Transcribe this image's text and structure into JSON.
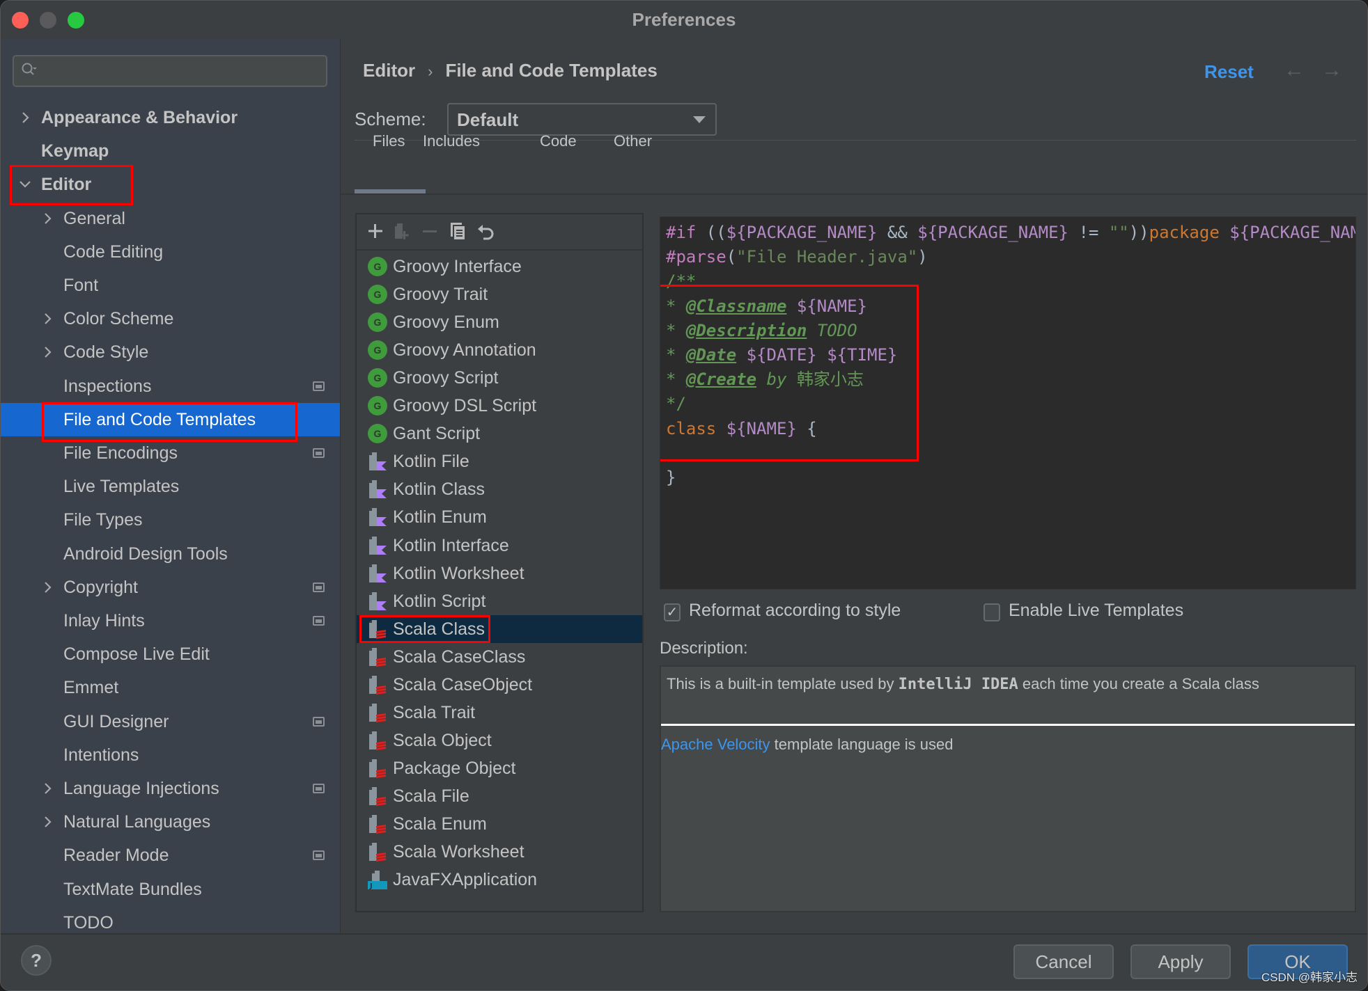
{
  "window": {
    "title": "Preferences"
  },
  "sidebar": {
    "search_placeholder": "",
    "items": [
      {
        "label": "Appearance & Behavior",
        "level": 0,
        "chevron": "right",
        "badge": false,
        "selected": false
      },
      {
        "label": "Keymap",
        "level": 0,
        "chevron": "none",
        "badge": false,
        "selected": false
      },
      {
        "label": "Editor",
        "level": 0,
        "chevron": "down",
        "badge": false,
        "selected": false
      },
      {
        "label": "General",
        "level": 1,
        "chevron": "right",
        "badge": false,
        "selected": false
      },
      {
        "label": "Code Editing",
        "level": 1,
        "chevron": "none",
        "badge": false,
        "selected": false
      },
      {
        "label": "Font",
        "level": 1,
        "chevron": "none",
        "badge": false,
        "selected": false
      },
      {
        "label": "Color Scheme",
        "level": 1,
        "chevron": "right",
        "badge": false,
        "selected": false
      },
      {
        "label": "Code Style",
        "level": 1,
        "chevron": "right",
        "badge": false,
        "selected": false
      },
      {
        "label": "Inspections",
        "level": 1,
        "chevron": "none",
        "badge": true,
        "selected": false
      },
      {
        "label": "File and Code Templates",
        "level": 1,
        "chevron": "none",
        "badge": false,
        "selected": true
      },
      {
        "label": "File Encodings",
        "level": 1,
        "chevron": "none",
        "badge": true,
        "selected": false
      },
      {
        "label": "Live Templates",
        "level": 1,
        "chevron": "none",
        "badge": false,
        "selected": false
      },
      {
        "label": "File Types",
        "level": 1,
        "chevron": "none",
        "badge": false,
        "selected": false
      },
      {
        "label": "Android Design Tools",
        "level": 1,
        "chevron": "none",
        "badge": false,
        "selected": false
      },
      {
        "label": "Copyright",
        "level": 1,
        "chevron": "right",
        "badge": true,
        "selected": false
      },
      {
        "label": "Inlay Hints",
        "level": 1,
        "chevron": "none",
        "badge": true,
        "selected": false
      },
      {
        "label": "Compose Live Edit",
        "level": 1,
        "chevron": "none",
        "badge": false,
        "selected": false
      },
      {
        "label": "Emmet",
        "level": 1,
        "chevron": "none",
        "badge": false,
        "selected": false
      },
      {
        "label": "GUI Designer",
        "level": 1,
        "chevron": "none",
        "badge": true,
        "selected": false
      },
      {
        "label": "Intentions",
        "level": 1,
        "chevron": "none",
        "badge": false,
        "selected": false
      },
      {
        "label": "Language Injections",
        "level": 1,
        "chevron": "right",
        "badge": true,
        "selected": false
      },
      {
        "label": "Natural Languages",
        "level": 1,
        "chevron": "right",
        "badge": false,
        "selected": false
      },
      {
        "label": "Reader Mode",
        "level": 1,
        "chevron": "none",
        "badge": true,
        "selected": false
      },
      {
        "label": "TextMate Bundles",
        "level": 1,
        "chevron": "none",
        "badge": false,
        "selected": false
      },
      {
        "label": "TODO",
        "level": 1,
        "chevron": "none",
        "badge": false,
        "selected": false
      }
    ]
  },
  "header": {
    "breadcrumb": [
      "Editor",
      "File and Code Templates"
    ],
    "breadcrumb_separator": "›",
    "reset_label": "Reset",
    "back_icon": "←",
    "forward_icon": "→"
  },
  "scheme": {
    "label": "Scheme:",
    "value": "Default"
  },
  "tabs": [
    {
      "label": "Files",
      "active": true
    },
    {
      "label": "Includes",
      "active": false
    },
    {
      "label": "Code",
      "active": false
    },
    {
      "label": "Other",
      "active": false
    }
  ],
  "toolbar": {
    "add": "add-icon",
    "add_child": "add-child-template-icon",
    "remove": "remove-icon",
    "copy": "copy-icon",
    "reset": "reset-icon"
  },
  "templates": [
    {
      "label": "Groovy Interface",
      "kind": "groovy"
    },
    {
      "label": "Groovy Trait",
      "kind": "groovy"
    },
    {
      "label": "Groovy Enum",
      "kind": "groovy"
    },
    {
      "label": "Groovy Annotation",
      "kind": "groovy"
    },
    {
      "label": "Groovy Script",
      "kind": "groovy"
    },
    {
      "label": "Groovy DSL Script",
      "kind": "groovy"
    },
    {
      "label": "Gant Script",
      "kind": "groovy"
    },
    {
      "label": "Kotlin File",
      "kind": "kotlin"
    },
    {
      "label": "Kotlin Class",
      "kind": "kotlin"
    },
    {
      "label": "Kotlin Enum",
      "kind": "kotlin"
    },
    {
      "label": "Kotlin Interface",
      "kind": "kotlin"
    },
    {
      "label": "Kotlin Worksheet",
      "kind": "kotlin"
    },
    {
      "label": "Kotlin Script",
      "kind": "kotlin"
    },
    {
      "label": "Scala Class",
      "kind": "scala",
      "selected": true
    },
    {
      "label": "Scala CaseClass",
      "kind": "scala"
    },
    {
      "label": "Scala CaseObject",
      "kind": "scala"
    },
    {
      "label": "Scala Trait",
      "kind": "scala"
    },
    {
      "label": "Scala Object",
      "kind": "scala"
    },
    {
      "label": "Package Object",
      "kind": "scala"
    },
    {
      "label": "Scala File",
      "kind": "scala"
    },
    {
      "label": "Scala Enum",
      "kind": "scala"
    },
    {
      "label": "Scala Worksheet",
      "kind": "scala"
    },
    {
      "label": "JavaFXApplication",
      "kind": "javafx"
    }
  ],
  "editor": {
    "lines": [
      [
        {
          "t": "#if",
          "c": "c-dir"
        },
        {
          "t": " ((",
          "c": "c-op"
        },
        {
          "t": "${PACKAGE_NAME}",
          "c": "c-var"
        },
        {
          "t": " && ",
          "c": "c-op"
        },
        {
          "t": "${PACKAGE_NAME}",
          "c": "c-var"
        },
        {
          "t": " != ",
          "c": "c-op"
        },
        {
          "t": "\"\"",
          "c": "c-str"
        },
        {
          "t": "))",
          "c": "c-op"
        },
        {
          "t": "package",
          "c": "c-kw"
        },
        {
          "t": " ${PACKAGE_NAME}",
          "c": "c-var"
        }
      ],
      [
        {
          "t": "#parse",
          "c": "c-dir"
        },
        {
          "t": "(",
          "c": "c-op"
        },
        {
          "t": "\"File Header.java\"",
          "c": "c-str"
        },
        {
          "t": ")",
          "c": "c-op"
        }
      ],
      [
        {
          "t": "/**",
          "c": "c-com"
        }
      ],
      [
        {
          "t": "* ",
          "c": "c-com"
        },
        {
          "t": "@Classname",
          "c": "c-tag"
        },
        {
          "t": " ",
          "c": "c-com"
        },
        {
          "t": "${NAME}",
          "c": "c-var"
        }
      ],
      [
        {
          "t": "* ",
          "c": "c-com"
        },
        {
          "t": "@Description",
          "c": "c-tag"
        },
        {
          "t": " TODO",
          "c": "c-it"
        }
      ],
      [
        {
          "t": "* ",
          "c": "c-com"
        },
        {
          "t": "@Date",
          "c": "c-tag"
        },
        {
          "t": " ",
          "c": "c-com"
        },
        {
          "t": "${DATE}",
          "c": "c-var"
        },
        {
          "t": " ",
          "c": "c-com"
        },
        {
          "t": "${TIME}",
          "c": "c-var"
        }
      ],
      [
        {
          "t": "* ",
          "c": "c-com"
        },
        {
          "t": "@Create",
          "c": "c-tag"
        },
        {
          "t": " by ",
          "c": "c-it"
        },
        {
          "t": "韩家小志",
          "c": "c-com"
        }
      ],
      [
        {
          "t": "*/",
          "c": "c-com"
        }
      ],
      [
        {
          "t": "class",
          "c": "c-kw"
        },
        {
          "t": " ",
          "c": "c-op"
        },
        {
          "t": "${NAME}",
          "c": "c-var"
        },
        {
          "t": " {",
          "c": "c-brace"
        }
      ],
      [],
      [
        {
          "t": "}",
          "c": "c-brace"
        }
      ]
    ]
  },
  "options": {
    "reformat": {
      "label": "Reformat according to style",
      "checked": true
    },
    "live_templates": {
      "label": "Enable Live Templates",
      "checked": false
    }
  },
  "description": {
    "label": "Description:",
    "text_before": "This is a built-in template used by ",
    "text_bold": "IntelliJ IDEA",
    "text_after": " each time you create a Scala class",
    "link": "Apache Velocity",
    "footer_rest": " template language is used"
  },
  "buttons": {
    "help": "?",
    "cancel": "Cancel",
    "apply": "Apply",
    "ok": "OK"
  },
  "watermark": "CSDN @韩家小志",
  "colors": {
    "accent": "#3d95ec",
    "selection": "#1667cf",
    "list_selection": "#0d2a40",
    "annotation_red": "#ff0000"
  }
}
